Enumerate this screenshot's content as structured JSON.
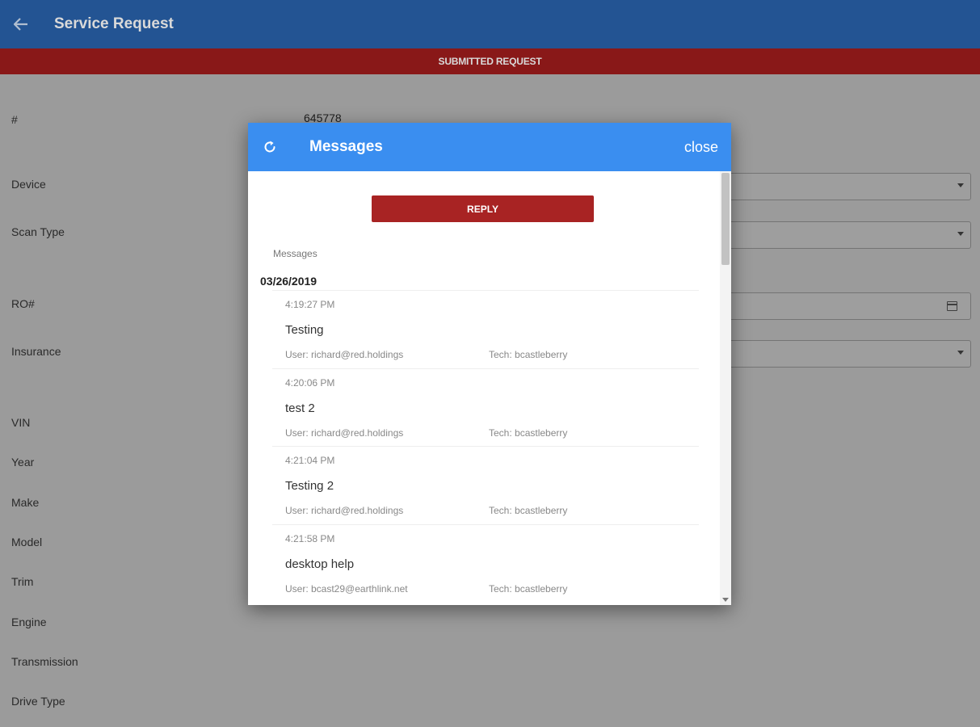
{
  "appbar": {
    "title": "Service Request",
    "back_icon": "arrow-left-icon"
  },
  "status_banner": {
    "text": "SUBMITTED REQUEST"
  },
  "form": {
    "fields": [
      {
        "label": "#",
        "value": "645778"
      },
      {
        "label": "Device"
      },
      {
        "label": "Scan Type"
      },
      {
        "label": "RO#"
      },
      {
        "label": "Insurance"
      },
      {
        "label": "VIN"
      },
      {
        "label": "Year"
      },
      {
        "label": "Make"
      },
      {
        "label": "Model"
      },
      {
        "label": "Trim"
      },
      {
        "label": "Engine"
      },
      {
        "label": "Transmission"
      },
      {
        "label": "Drive Type"
      }
    ]
  },
  "dialog": {
    "title": "Messages",
    "close_label": "close",
    "refresh_icon": "refresh-icon",
    "reply_label": "REPLY",
    "section_label": "Messages",
    "date": "03/26/2019",
    "messages": [
      {
        "time": "4:19:27 PM",
        "text": "Testing",
        "user": "User: richard@red.holdings",
        "tech": "Tech: bcastleberry"
      },
      {
        "time": "4:20:06 PM",
        "text": "test 2",
        "user": "User: richard@red.holdings",
        "tech": "Tech: bcastleberry"
      },
      {
        "time": "4:21:04 PM",
        "text": "Testing 2",
        "user": "User: richard@red.holdings",
        "tech": "Tech: bcastleberry"
      },
      {
        "time": "4:21:58 PM",
        "text": "desktop help",
        "user": "User: bcast29@earthlink.net",
        "tech": "Tech: bcastleberry"
      }
    ]
  },
  "colors": {
    "appbar": "#2a63ad",
    "status_banner": "#a11d1d",
    "dialog_header": "#3a8ef0",
    "reply_button": "#a82323"
  }
}
